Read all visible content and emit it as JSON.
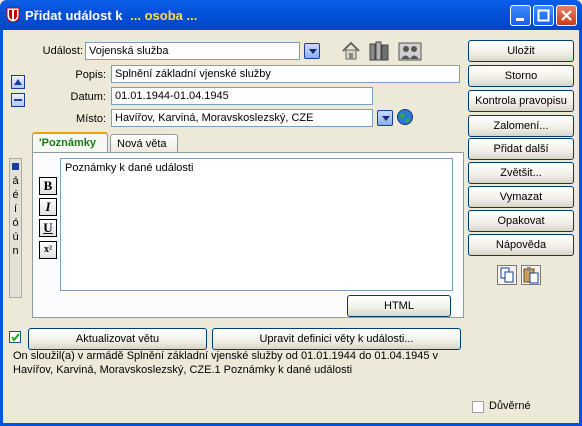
{
  "window": {
    "title": "Přidat událost k",
    "title_sub": "... osoba ..."
  },
  "form": {
    "event_label": "Událost:",
    "event_value": "Vojenská služba",
    "description_label": "Popis:",
    "description_value": "Splnění základní vjenské služby",
    "date_label": "Datum:",
    "date_value": "01.01.1944-01.04.1945",
    "place_label": "Místo:",
    "place_value": "Havířov, Karviná, Moravskoslezský, CZE"
  },
  "tabs": [
    {
      "label": "'Poznámky",
      "active": true
    },
    {
      "label": "Nová věta",
      "active": false
    }
  ],
  "notes": {
    "text": "Poznámky k dané události"
  },
  "format_buttons": {
    "bold": "B",
    "italic": "I",
    "underline": "U",
    "superscript": "x²"
  },
  "side_chars": [
    "á",
    "é",
    "í",
    "ó",
    "ú",
    "n"
  ],
  "buttons": {
    "html": "HTML",
    "update_sentence": "Aktualizovat větu",
    "edit_sentence_def": "Upravit definici věty k události...",
    "save": "Uložit",
    "cancel": "Storno",
    "spellcheck": "Kontrola pravopisu",
    "breaks": "Zalomení...",
    "add_next": "Přidat další",
    "enlarge": "Zvětšit...",
    "delete": "Vymazat",
    "repeat": "Opakovat",
    "help": "Nápověda"
  },
  "sentence_preview": "On sloužil(a) v armádě Splnění základní vjenské služby od 01.01.1944 do 01.04.1945 v Havířov, Karviná, Moravskoslezský, CZE.1 Poznámky k dané události",
  "confidential_label": "Důvěrné",
  "update_checkbox_checked": true,
  "confidential_checked": false,
  "colors": {
    "titlebar": "#0054e3",
    "title_sub": "#ffe040",
    "active_tab_text": "#1a7a1a"
  }
}
